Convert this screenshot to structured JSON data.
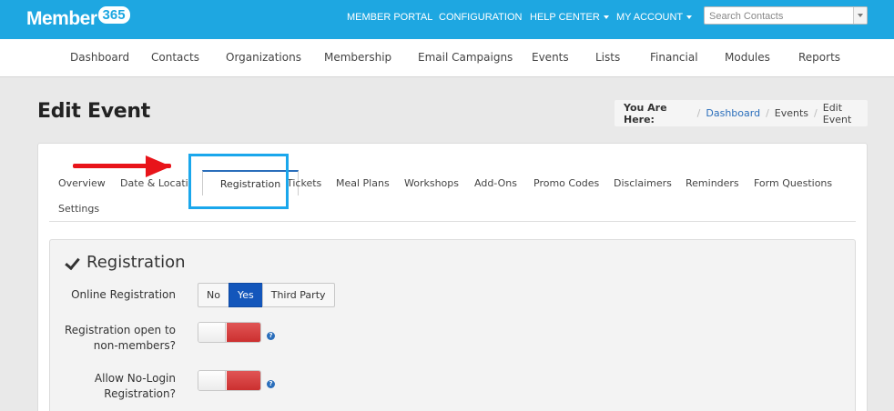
{
  "app": {
    "logo_text": "Member",
    "logo_number": "365"
  },
  "topnav": {
    "items": [
      {
        "label": "MEMBER PORTAL"
      },
      {
        "label": "CONFIGURATION"
      },
      {
        "label": "HELP CENTER"
      },
      {
        "label": "MY ACCOUNT"
      }
    ],
    "search_placeholder": "Search Contacts"
  },
  "mainnav": {
    "items": [
      {
        "label": "Dashboard"
      },
      {
        "label": "Contacts"
      },
      {
        "label": "Organizations"
      },
      {
        "label": "Membership"
      },
      {
        "label": "Email Campaigns"
      },
      {
        "label": "Events"
      },
      {
        "label": "Lists"
      },
      {
        "label": "Financial"
      },
      {
        "label": "Modules"
      },
      {
        "label": "Reports"
      }
    ]
  },
  "page": {
    "title": "Edit Event"
  },
  "breadcrumb": {
    "label": "You Are Here:",
    "items": [
      "Dashboard",
      "Events",
      "Edit Event"
    ],
    "separator": "/"
  },
  "tabs": {
    "items": [
      "Overview",
      "Date & Location",
      "Registration",
      "Tickets",
      "Meal Plans",
      "Workshops",
      "Add-Ons",
      "Promo Codes",
      "Disclaimers",
      "Reminders",
      "Form Questions",
      "Settings"
    ],
    "active": "Registration"
  },
  "section": {
    "title": "Registration",
    "online_registration": {
      "label": "Online Registration",
      "options": [
        "No",
        "Yes",
        "Third Party"
      ],
      "selected": "Yes"
    },
    "open_non_members": {
      "label_line1": "Registration open to",
      "label_line2": "non-members?",
      "value": "on"
    },
    "allow_no_login": {
      "label_line1": "Allow No-Login",
      "label_line2": "Registration?",
      "value": "on"
    },
    "help_glyph": "?"
  },
  "colors": {
    "topbar": "#1ea7e1",
    "active_button": "#1356bb",
    "toggle_on": "#cc3030",
    "highlight": "#1aa7ec",
    "arrow": "#e8141a"
  }
}
